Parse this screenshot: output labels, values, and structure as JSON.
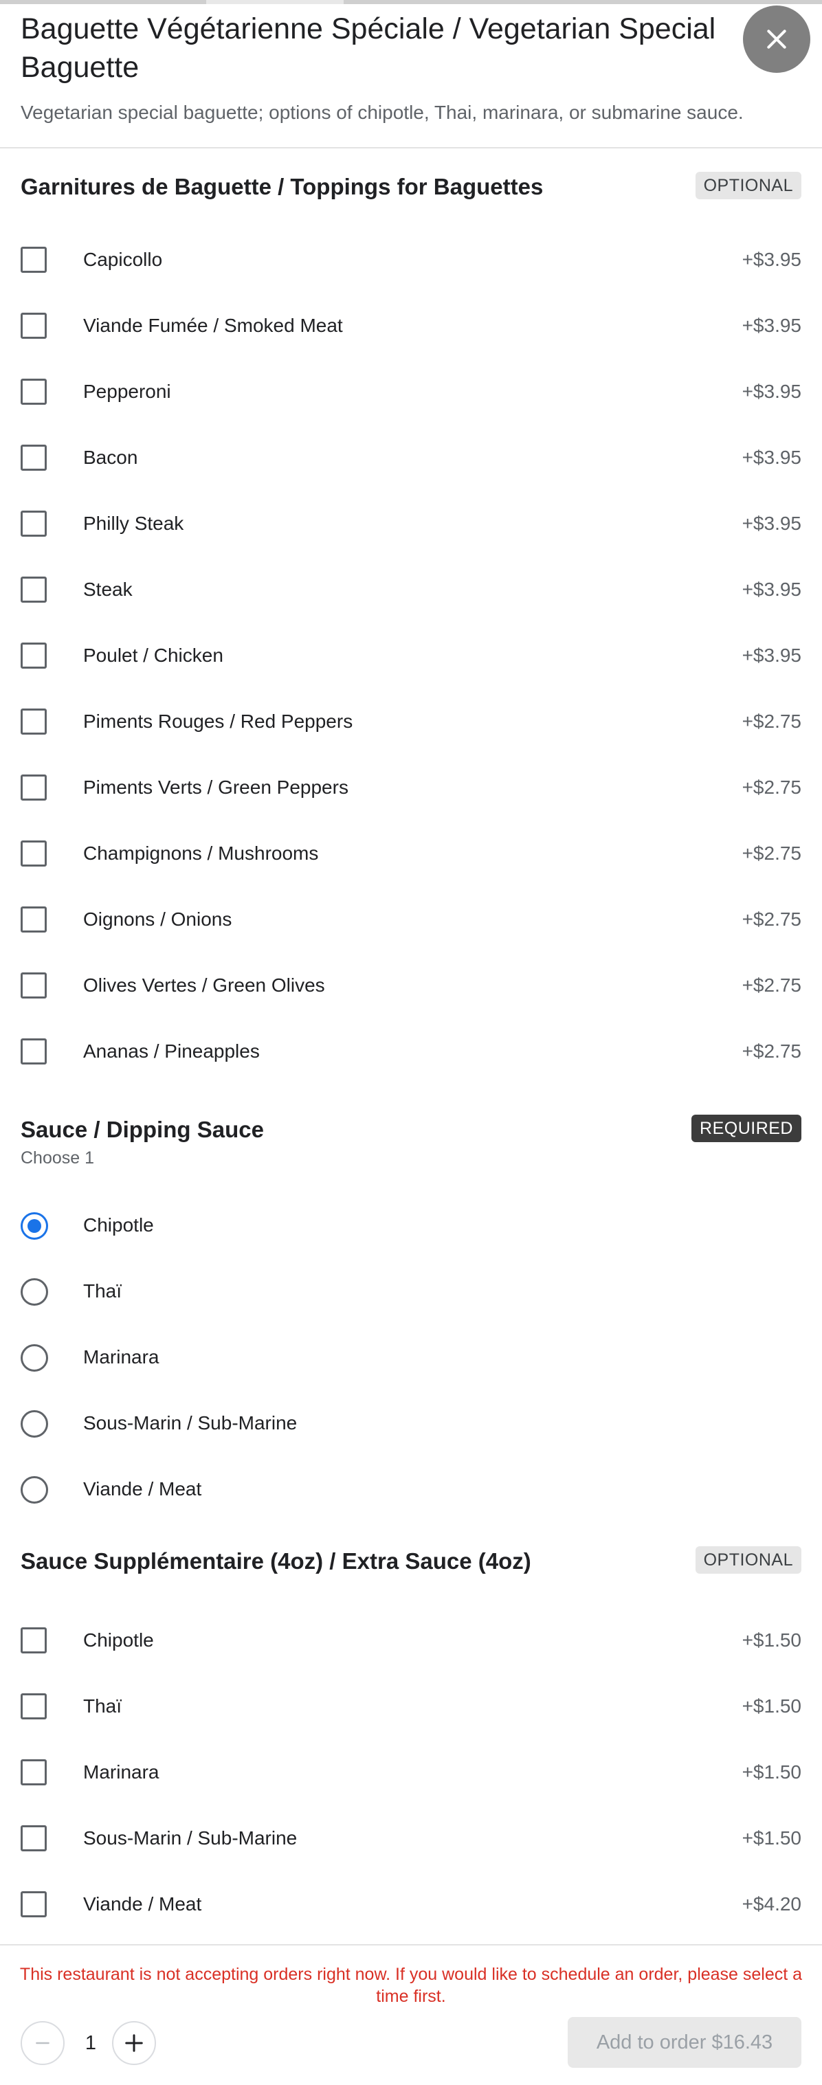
{
  "header": {
    "title": "Baguette Végétarienne Spéciale / Vegetarian Special Baguette",
    "description": "Vegetarian special baguette; options of chipotle, Thai, marinara, or submarine sauce.",
    "close_icon": "close-icon"
  },
  "toppings": {
    "title": "Garnitures de Baguette / Toppings for Baguettes",
    "badge": "OPTIONAL",
    "items": [
      {
        "label": "Capicollo",
        "price": "+$3.95"
      },
      {
        "label": "Viande Fumée / Smoked Meat",
        "price": "+$3.95"
      },
      {
        "label": "Pepperoni",
        "price": "+$3.95"
      },
      {
        "label": "Bacon",
        "price": "+$3.95"
      },
      {
        "label": "Philly Steak",
        "price": "+$3.95"
      },
      {
        "label": "Steak",
        "price": "+$3.95"
      },
      {
        "label": "Poulet / Chicken",
        "price": "+$3.95"
      },
      {
        "label": "Piments Rouges / Red Peppers",
        "price": "+$2.75"
      },
      {
        "label": "Piments Verts / Green Peppers",
        "price": "+$2.75"
      },
      {
        "label": "Champignons / Mushrooms",
        "price": "+$2.75"
      },
      {
        "label": "Oignons / Onions",
        "price": "+$2.75"
      },
      {
        "label": "Olives Vertes / Green Olives",
        "price": "+$2.75"
      },
      {
        "label": "Ananas / Pineapples",
        "price": "+$2.75"
      }
    ]
  },
  "sauce": {
    "title": "Sauce / Dipping Sauce",
    "subtitle": "Choose 1",
    "badge": "REQUIRED",
    "selected": "Chipotle",
    "items": [
      {
        "label": "Chipotle"
      },
      {
        "label": "Thaï"
      },
      {
        "label": "Marinara"
      },
      {
        "label": "Sous-Marin / Sub-Marine"
      },
      {
        "label": "Viande / Meat"
      }
    ]
  },
  "extra_sauce": {
    "title": "Sauce Supplémentaire (4oz) / Extra Sauce (4oz)",
    "badge": "OPTIONAL",
    "items": [
      {
        "label": "Chipotle",
        "price": "+$1.50"
      },
      {
        "label": "Thaï",
        "price": "+$1.50"
      },
      {
        "label": "Marinara",
        "price": "+$1.50"
      },
      {
        "label": "Sous-Marin / Sub-Marine",
        "price": "+$1.50"
      },
      {
        "label": "Viande / Meat",
        "price": "+$4.20"
      }
    ]
  },
  "footer": {
    "notice": "This restaurant is not accepting orders right now. If you would like to schedule an order, please select a time first.",
    "quantity": "1",
    "add_button": "Add to order $16.43"
  },
  "colors": {
    "accent": "#1a73e8",
    "notice": "#d93025",
    "required_badge": "#3c3c3c",
    "optional_badge": "#e6e6e6"
  }
}
